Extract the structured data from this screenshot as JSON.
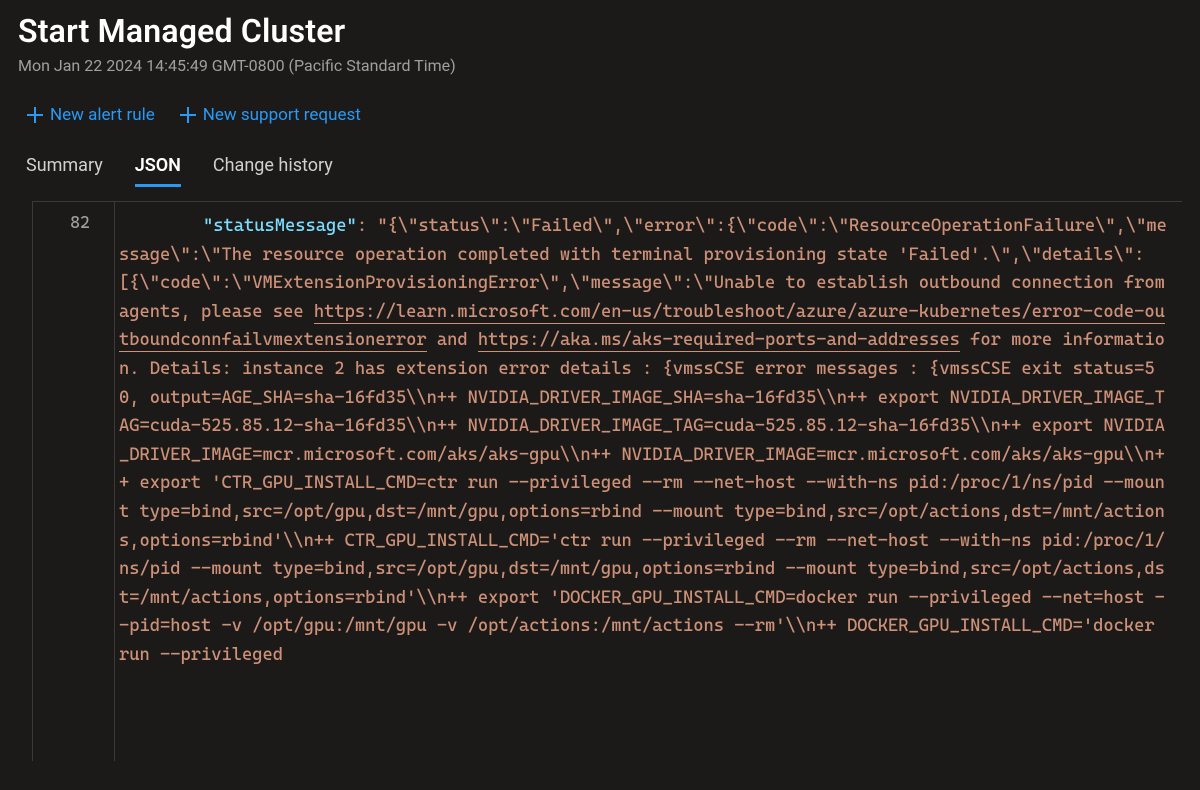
{
  "header": {
    "title": "Start Managed Cluster",
    "timestamp": "Mon Jan 22 2024 14:45:49 GMT-0800 (Pacific Standard Time)"
  },
  "actions": {
    "new_alert_rule": "New alert rule",
    "new_support_request": "New support request"
  },
  "tabs": {
    "summary": "Summary",
    "json": "JSON",
    "change_history": "Change history",
    "active": "json"
  },
  "json_view": {
    "line_number": "82",
    "key": "\"statusMessage\"",
    "value_pre": ": \"{\\\"status\\\":\\\"Failed\\\",\\\"error\\\":{\\\"code\\\":\\\"ResourceOperationFailure\\\",\\\"message\\\":\\\"The resource operation completed with terminal provisioning state 'Failed'.\\\",\\\"details\\\":[{\\\"code\\\":\\\"VMExtensionProvisioningError\\\",\\\"message\\\":\\\"Unable to establish outbound connection from agents, please see ",
    "link1": "https://learn.microsoft.com/en-us/troubleshoot/azure/azure-kubernetes/error-code-outboundconnfailvmextensionerror",
    "mid1": " and ",
    "link2": "https://aka.ms/aks-required-ports-and-addresses",
    "value_post": " for more information. Details: instance 2 has extension error details : {vmssCSE error messages : {vmssCSE exit status=50, output=AGE_SHA=sha-16fd35\\\\n++ NVIDIA_DRIVER_IMAGE_SHA=sha-16fd35\\\\n++ export NVIDIA_DRIVER_IMAGE_TAG=cuda-525.85.12-sha-16fd35\\\\n++ NVIDIA_DRIVER_IMAGE_TAG=cuda-525.85.12-sha-16fd35\\\\n++ export NVIDIA_DRIVER_IMAGE=mcr.microsoft.com/aks/aks-gpu\\\\n++ NVIDIA_DRIVER_IMAGE=mcr.microsoft.com/aks/aks-gpu\\\\n++ export 'CTR_GPU_INSTALL_CMD=ctr run --privileged --rm --net-host --with-ns pid:/proc/1/ns/pid --mount type=bind,src=/opt/gpu,dst=/mnt/gpu,options=rbind --mount type=bind,src=/opt/actions,dst=/mnt/actions,options=rbind'\\\\n++ CTR_GPU_INSTALL_CMD='ctr run --privileged --rm --net-host --with-ns pid:/proc/1/ns/pid --mount type=bind,src=/opt/gpu,dst=/mnt/gpu,options=rbind --mount type=bind,src=/opt/actions,dst=/mnt/actions,options=rbind'\\\\n++ export 'DOCKER_GPU_INSTALL_CMD=docker run --privileged --net=host --pid=host -v /opt/gpu:/mnt/gpu -v /opt/actions:/mnt/actions --rm'\\\\n++ DOCKER_GPU_INSTALL_CMD='docker run --privileged"
  }
}
